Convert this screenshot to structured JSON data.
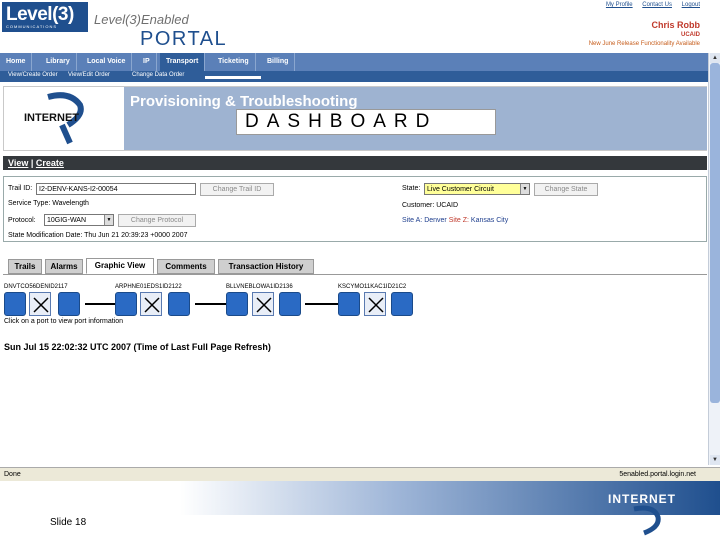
{
  "header": {
    "logo_main": "Level(3)",
    "logo_sub": "COMMUNICATIONS",
    "enabled_text": "Level(3)Enabled",
    "portal_text": "PORTAL",
    "links": [
      "My Profile",
      "Contact Us",
      "Logout"
    ],
    "user_name": "Chris Robb",
    "user_org": "UCAID",
    "release_note": "New June Release Functionality Available"
  },
  "nav": {
    "items": [
      "Home",
      "Library",
      "Local Voice",
      "IP",
      "Transport",
      "Ticketing",
      "Billing"
    ],
    "active": "Transport",
    "sub_items": [
      "View/Create Order",
      "View/Edit Order",
      "Change Data Order"
    ]
  },
  "banner": {
    "title": "Provisioning & Troubleshooting",
    "dashboard": "DASHBOARD",
    "logo_text": "INTERNET"
  },
  "vcbar": {
    "view": "View",
    "sep": "|",
    "create": "Create"
  },
  "info": {
    "trail_id_label": "Trail ID:",
    "trail_id_value": "I2-DENV-KANS-I2-00054",
    "change_trail_btn": "Change Trail ID",
    "service_type": "Service Type:  Wavelength",
    "protocol_label": "Protocol:",
    "protocol_value": "10GIG-WAN",
    "change_protocol_btn": "Change Protocol",
    "state_mod": "State Modification Date:  Thu Jun 21 20:39:23 +0000 2007",
    "state_label": "State:",
    "state_value": "Live Customer Circuit",
    "change_state_btn": "Change State",
    "customer": "Customer:  UCAID",
    "site_a_label": "Site A:",
    "site_a_value": "Denver",
    "site_z_label": "Site Z:",
    "site_z_value": "Kansas City"
  },
  "tabs": [
    "Trails",
    "Alarms",
    "Graphic View",
    "Comments",
    "Transaction History"
  ],
  "active_tab": "Graphic View",
  "graphic": {
    "nodes": [
      "DNVTCO56DENID2117",
      "ARPHNE01EDS1ID2122",
      "BLLVNEBLOWA1ID2136",
      "KSCYMO11KAC1ID21C2"
    ],
    "hint": "Click on a port to view port information",
    "refresh": "Sun Jul 15 22:02:32 UTC 2007 (Time of Last Full Page Refresh)"
  },
  "status": {
    "done": "Done",
    "url": "5enabled.portal.login.net"
  },
  "footer": {
    "slide": "Slide 18",
    "logo_text": "INTERNET"
  },
  "colors": {
    "brand_blue": "#1f4f8e",
    "nav_blue": "#5b80b8",
    "accent_red": "#c0392b",
    "state_highlight": "#ffff99"
  }
}
